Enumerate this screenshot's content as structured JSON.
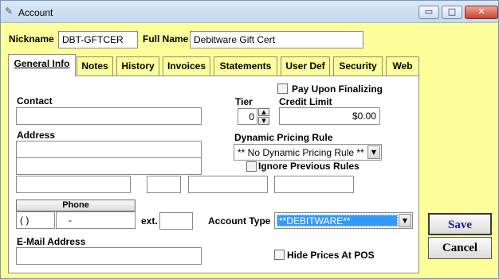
{
  "window": {
    "title": "Account",
    "minimize": "▭",
    "maximize": "□",
    "close": "✕"
  },
  "header": {
    "nickname_label": "Nickname",
    "nickname_value": "DBT-GFTCER",
    "fullname_label": "Full Name",
    "fullname_value": "Debitware Gift Cert"
  },
  "tabs": [
    "General Info",
    "Notes",
    "History",
    "Invoices",
    "Statements",
    "User Def",
    "Security",
    "Web"
  ],
  "general": {
    "pay_upon_finalizing": "Pay Upon Finalizing",
    "contact_label": "Contact",
    "tier_label": "Tier",
    "tier_value": "0",
    "credit_limit_label": "Credit Limit",
    "credit_limit_value": "$0.00",
    "address_label": "Address",
    "dynamic_pricing_label": "Dynamic Pricing Rule",
    "dynamic_pricing_value": "** No Dynamic Pricing Rule **",
    "ignore_previous_rules": "Ignore Previous Rules",
    "phone_button": "Phone",
    "phone_area": "(  )",
    "phone_number": "-",
    "ext_label": "ext.",
    "account_type_label": "Account Type",
    "account_type_value": "**DEBITWARE**",
    "email_label": "E-Mail Address",
    "hide_prices": "Hide Prices At POS"
  },
  "actions": {
    "save": "Save",
    "cancel": "Cancel"
  },
  "colors": {
    "background": "#fdfd99",
    "selection": "#3399ff",
    "save_text": "#1a1aa6"
  }
}
